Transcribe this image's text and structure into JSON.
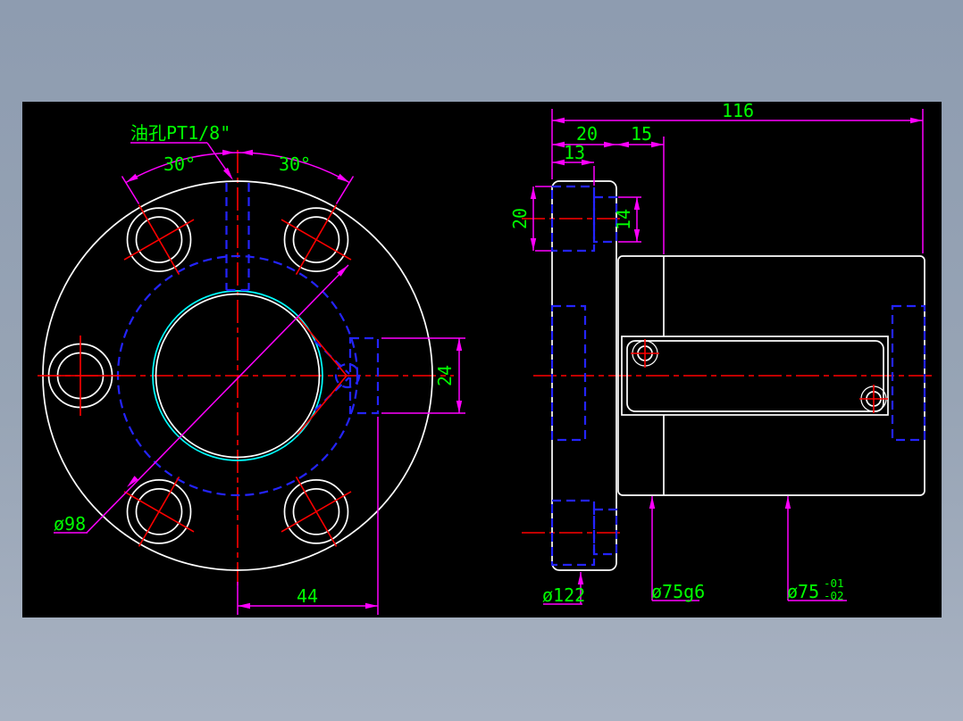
{
  "window": {
    "canvas_color": "#000000",
    "frame_color": "#97a4b5"
  },
  "palette": {
    "object_lines": "#ffffff",
    "hidden_lines": "#2424ff",
    "center_lines": "#ff0000",
    "dimension_lines": "#ff00ff",
    "dimension_text": "#00ff00",
    "fit_circle": "#00ffff"
  },
  "front_view": {
    "labels": {
      "oil_port": "油孔PT1/8\"",
      "angle_left": "30°",
      "angle_right": "30°",
      "bolt_circle": "ø98",
      "flat_offset": "44",
      "flat_width": "24"
    }
  },
  "side_view": {
    "labels": {
      "overall_length": "116",
      "flange_thickness": "20",
      "spacer_width": "15",
      "counterbore_depth": "13",
      "counterbore_dia": "20",
      "bolt_hole_dia": "14",
      "flange_dia": "ø122",
      "body_fit_dia": "ø75g6",
      "body_dia": "ø75",
      "body_tol_upper": "-01",
      "body_tol_lower": "-02"
    }
  }
}
